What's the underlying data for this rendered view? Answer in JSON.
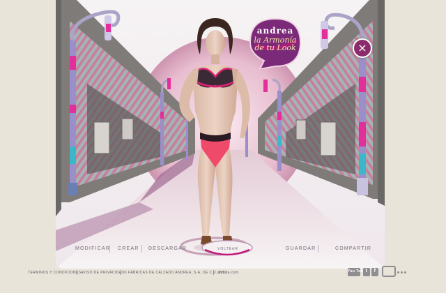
{
  "brand": {
    "name": "andrea",
    "tagline": "la Armonía de tu Look",
    "colors": {
      "magenta": "#c2187a",
      "purple": "#7a2a78",
      "bg": "#e9e4da"
    }
  },
  "model": {
    "bra_color": "#3a2a35",
    "bra_trim": "#d5246f",
    "panty_color": "#f04a6a",
    "panty_lace": "#2a1a22"
  },
  "controls": {
    "close_icon": "×",
    "voltear_label": "VOLTEAR"
  },
  "nav": {
    "modificar": "MODIFICAR",
    "crear": "CREAR",
    "descargar": "DESCARGAR",
    "guardar": "GUARDAR",
    "compartir": "COMPARTIR"
  },
  "footer": {
    "terms": "TÉRMINOS Y CONDICIONES",
    "privacy": "AVISO DE PRIVACIDAD",
    "copyright": "© FÁBRICAS DE CALZADO ANDREA, S.A. DE C.V. 2012",
    "site": "andrea.com",
    "youtube": "You Tube",
    "twitter": "t",
    "facebook": "f"
  }
}
